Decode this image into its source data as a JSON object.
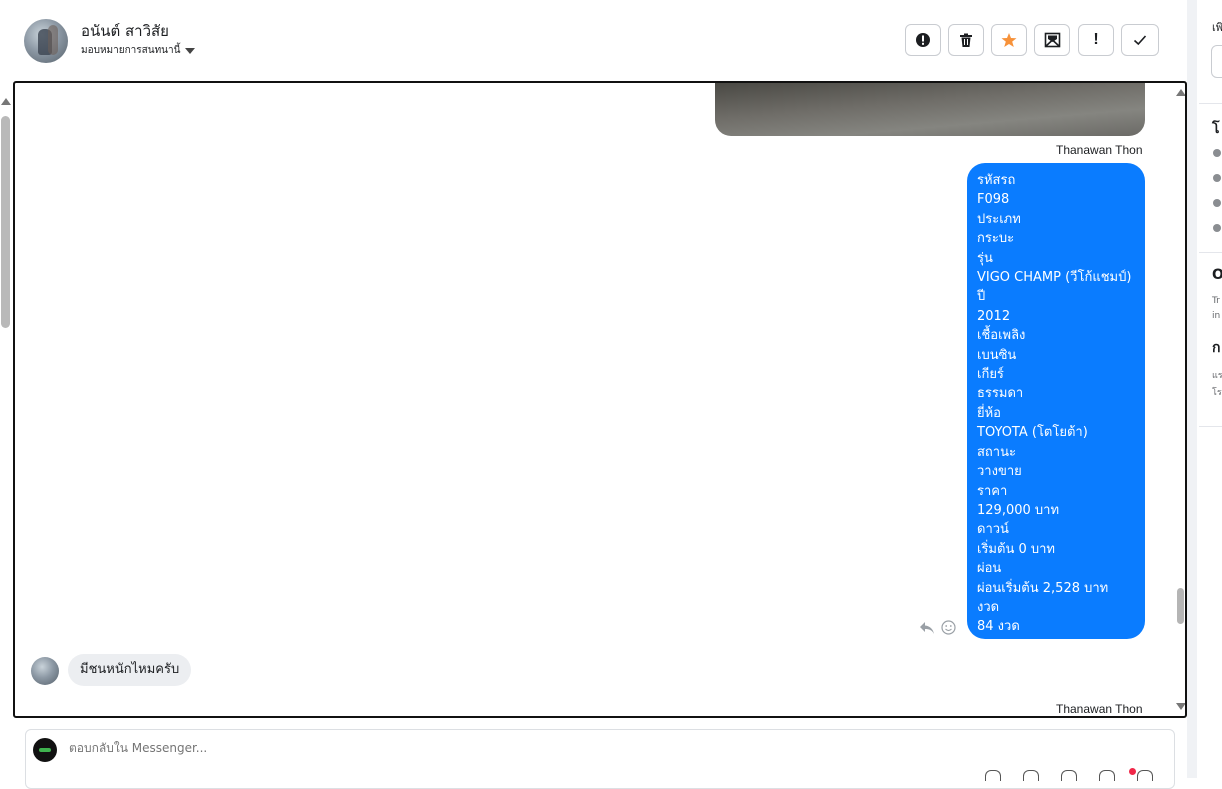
{
  "header": {
    "contact_name": "อนันต์ สาวิสัย",
    "assign_label": "มอบหมายการสนทนานี้"
  },
  "toolbar": [
    {
      "name": "spam-button",
      "icon": "alert-circle-icon",
      "glyph": "!"
    },
    {
      "name": "delete-button",
      "icon": "trash-icon",
      "glyph": ""
    },
    {
      "name": "star-button",
      "icon": "star-icon",
      "glyph": "★"
    },
    {
      "name": "mark-unread-button",
      "icon": "mail-icon",
      "glyph": ""
    },
    {
      "name": "follow-up-button",
      "icon": "exclamation-icon",
      "glyph": "!"
    },
    {
      "name": "done-button",
      "icon": "check-icon",
      "glyph": "✓"
    }
  ],
  "conversation": {
    "sender_top": "Thanawan Thon",
    "outgoing_lines": [
      "รหัสรถ",
      "F098",
      "ประเภท",
      "กระบะ",
      "รุ่น",
      "VIGO CHAMP (วีโก้แชมป์)",
      "ปี",
      "2012",
      "เชื้อเพลิง",
      "เบนซิน",
      "เกียร์",
      "ธรรมดา",
      "ยี่ห้อ",
      "TOYOTA (โตโยต้า)",
      "สถานะ",
      "วางขาย",
      "ราคา",
      "129,000 บาท",
      "ดาวน์",
      "เริ่มต้น 0 บาท",
      "ผ่อน",
      "ผ่อนเริ่มต้น 2,528 บาท",
      "งวด",
      "84 งวด"
    ],
    "incoming_text": "มีชนหนักไหมครับ",
    "sender_bottom": "Thanawan Thon"
  },
  "composer": {
    "placeholder": "ตอบกลับใน Messenger..."
  },
  "right_panel": {
    "label_top": "เพิ",
    "section_1": "โ",
    "section_2": "O",
    "text_2a": "Tr",
    "text_2b": "in",
    "section_3": "ก",
    "text_3a": "แร",
    "text_3b": "โร"
  },
  "colors": {
    "outgoing_bubble": "#0a7cff",
    "incoming_bubble": "#eceef1",
    "star": "#f7923a"
  }
}
